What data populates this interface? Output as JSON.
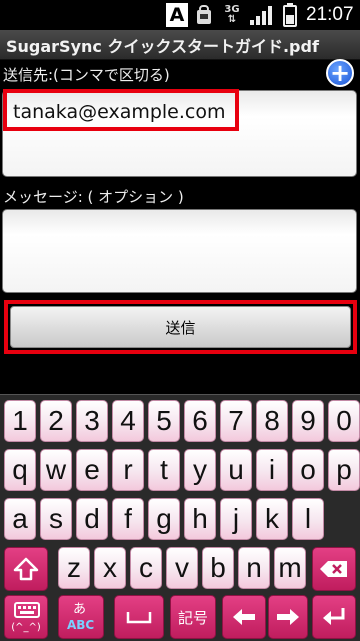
{
  "status_bar": {
    "keyboard_mode": "A",
    "network": "3G",
    "time": "21:07",
    "icons": [
      "input-mode-icon",
      "notification-bag-icon",
      "3g-data-icon",
      "signal-icon",
      "battery-icon"
    ]
  },
  "title": "SugarSync クイックスタートガイド.pdf",
  "form": {
    "to_label": "送信先:(コンマで区切る)",
    "to_value": "tanaka@example.com",
    "message_label": "メッセージ: ( オプション )",
    "message_value": "",
    "send_label": "送信"
  },
  "colors": {
    "highlight": "#e8000f",
    "key_pink": "#c01d5e",
    "add_button": "#1a55d6"
  },
  "keyboard": {
    "row1": [
      "1",
      "2",
      "3",
      "4",
      "5",
      "6",
      "7",
      "8",
      "9",
      "0"
    ],
    "row2": [
      "q",
      "w",
      "e",
      "r",
      "t",
      "y",
      "u",
      "i",
      "o",
      "p"
    ],
    "row3": [
      "a",
      "s",
      "d",
      "f",
      "g",
      "h",
      "j",
      "k",
      "l"
    ],
    "row4": [
      "z",
      "x",
      "c",
      "v",
      "b",
      "n",
      "m"
    ],
    "bottom": {
      "mode_label": "(^_^)",
      "kana_label": "あ",
      "abc_label": "ABC",
      "symbol_label": "記号"
    }
  }
}
